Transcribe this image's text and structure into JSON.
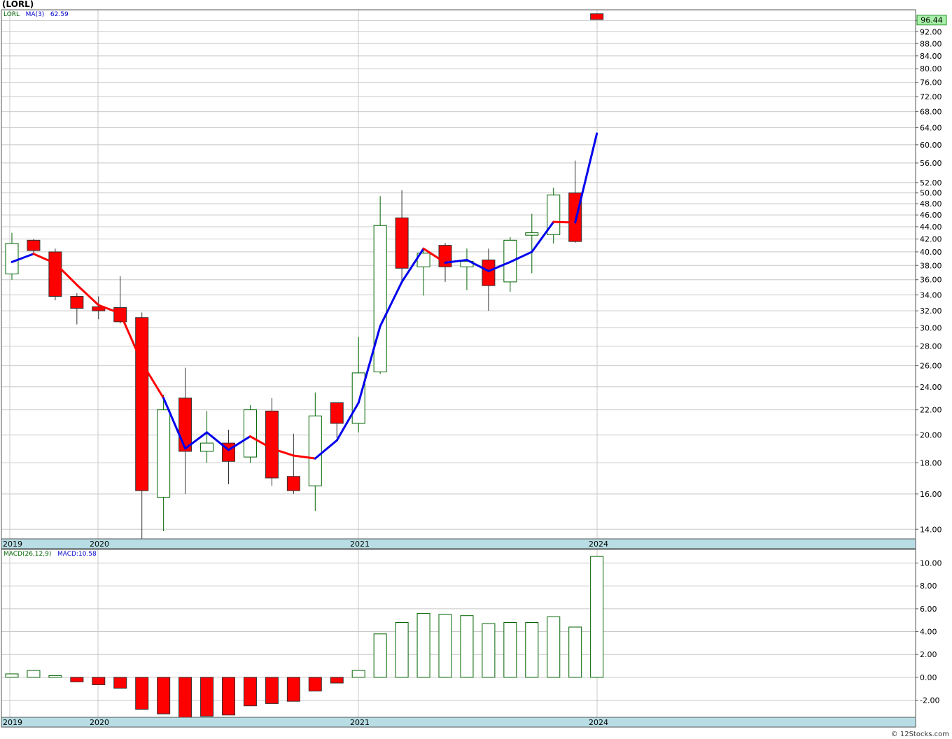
{
  "header": {
    "title": "(LORL)",
    "symbol": "LORL",
    "ma_label": "MA(3)",
    "ma_value": "62.59",
    "last_price": "96.44",
    "macd_label": "MACD(26,12,9)",
    "macd_value_label": "MACD:10.58",
    "watermark": "© 12Stocks.com"
  },
  "colors": {
    "up": "#006400",
    "down_fill": "#ff0000",
    "ma_up": "#0000ee",
    "ma_down": "#ff0000",
    "axis_band": "#b8dde4",
    "grid": "#c8c8c8",
    "price_badge": "#a8f0a8"
  },
  "chart_data": [
    {
      "type": "candlestick",
      "title": "(LORL)",
      "yscale": "log",
      "ylim": [
        13.5,
        100
      ],
      "x_labels": [
        "2019",
        "2020",
        "2021",
        "2024"
      ],
      "y_ticks": [
        14,
        16,
        18,
        20,
        22,
        24,
        26,
        28,
        30,
        32,
        34,
        36,
        38,
        40,
        42,
        44,
        46,
        48,
        50,
        52,
        56,
        60,
        64,
        68,
        72,
        76,
        80,
        84,
        88,
        92,
        96
      ],
      "candles": [
        {
          "o": 36.8,
          "h": 43.0,
          "l": 36.0,
          "c": 41.3
        },
        {
          "o": 41.8,
          "h": 42.0,
          "l": 39.8,
          "c": 40.2
        },
        {
          "o": 40.0,
          "h": 40.5,
          "l": 33.3,
          "c": 33.8
        },
        {
          "o": 33.8,
          "h": 34.2,
          "l": 30.4,
          "c": 32.3
        },
        {
          "o": 32.5,
          "h": 33.8,
          "l": 31.0,
          "c": 32.0
        },
        {
          "o": 32.4,
          "h": 36.5,
          "l": 30.5,
          "c": 30.7
        },
        {
          "o": 31.2,
          "h": 31.8,
          "l": 13.5,
          "c": 16.2
        },
        {
          "o": 15.8,
          "h": 23.3,
          "l": 13.9,
          "c": 22.0
        },
        {
          "o": 23.0,
          "h": 25.8,
          "l": 16.0,
          "c": 18.8
        },
        {
          "o": 18.8,
          "h": 21.9,
          "l": 18.0,
          "c": 19.4
        },
        {
          "o": 19.4,
          "h": 20.4,
          "l": 16.6,
          "c": 18.1
        },
        {
          "o": 18.4,
          "h": 22.4,
          "l": 18.0,
          "c": 22.0
        },
        {
          "o": 21.9,
          "h": 23.0,
          "l": 16.5,
          "c": 17.0
        },
        {
          "o": 17.1,
          "h": 20.1,
          "l": 16.0,
          "c": 16.2
        },
        {
          "o": 16.5,
          "h": 23.5,
          "l": 15.0,
          "c": 21.5
        },
        {
          "o": 22.6,
          "h": 22.6,
          "l": 19.8,
          "c": 20.9
        },
        {
          "o": 20.9,
          "h": 29.0,
          "l": 20.2,
          "c": 25.3
        },
        {
          "o": 25.4,
          "h": 49.4,
          "l": 25.2,
          "c": 44.2
        },
        {
          "o": 45.5,
          "h": 50.5,
          "l": 35.5,
          "c": 37.6
        },
        {
          "o": 37.8,
          "h": 40.5,
          "l": 33.9,
          "c": 39.8
        },
        {
          "o": 41.0,
          "h": 41.4,
          "l": 35.7,
          "c": 37.8
        },
        {
          "o": 37.8,
          "h": 40.5,
          "l": 34.6,
          "c": 38.6
        },
        {
          "o": 38.8,
          "h": 40.5,
          "l": 32.0,
          "c": 35.2
        },
        {
          "o": 35.7,
          "h": 42.3,
          "l": 34.4,
          "c": 41.8
        },
        {
          "o": 42.6,
          "h": 46.2,
          "l": 36.9,
          "c": 43.0
        },
        {
          "o": 42.7,
          "h": 51.0,
          "l": 41.3,
          "c": 49.6
        },
        {
          "o": 50.0,
          "h": 56.5,
          "l": 41.4,
          "c": 41.6
        },
        {
          "o": 98.5,
          "h": 98.5,
          "l": 96.4,
          "c": 96.4
        }
      ],
      "ma": [
        38.5,
        39.7,
        38.3,
        35.3,
        32.7,
        31.7,
        26.3,
        23.0,
        19.0,
        20.2,
        18.9,
        19.9,
        19.0,
        18.5,
        18.3,
        19.6,
        22.6,
        30.2,
        35.7,
        40.5,
        38.4,
        38.8,
        37.2,
        38.5,
        40.0,
        44.8,
        44.7,
        62.6
      ],
      "ma_color": [
        "b",
        "b",
        "r",
        "r",
        "r",
        "r",
        "r",
        "r",
        "b",
        "b",
        "b",
        "b",
        "r",
        "r",
        "r",
        "b",
        "b",
        "b",
        "b",
        "b",
        "r",
        "b",
        "b",
        "b",
        "b",
        "b",
        "r",
        "b"
      ]
    },
    {
      "type": "bar",
      "title": "MACD(26,12,9)",
      "ylim": [
        -3.5,
        11.2
      ],
      "y_ticks": [
        -2.0,
        0.0,
        2.0,
        4.0,
        6.0,
        8.0,
        10.0
      ],
      "x_labels": [
        "2019",
        "2020",
        "2021",
        "2024"
      ],
      "values": [
        0.3,
        0.6,
        0.15,
        -0.4,
        -0.65,
        -0.95,
        -2.8,
        -3.2,
        -3.5,
        -3.4,
        -3.3,
        -2.5,
        -2.3,
        -2.1,
        -1.2,
        -0.5,
        0.6,
        3.8,
        4.8,
        5.6,
        5.5,
        5.4,
        4.7,
        4.8,
        4.8,
        5.3,
        4.4,
        10.58
      ]
    }
  ]
}
